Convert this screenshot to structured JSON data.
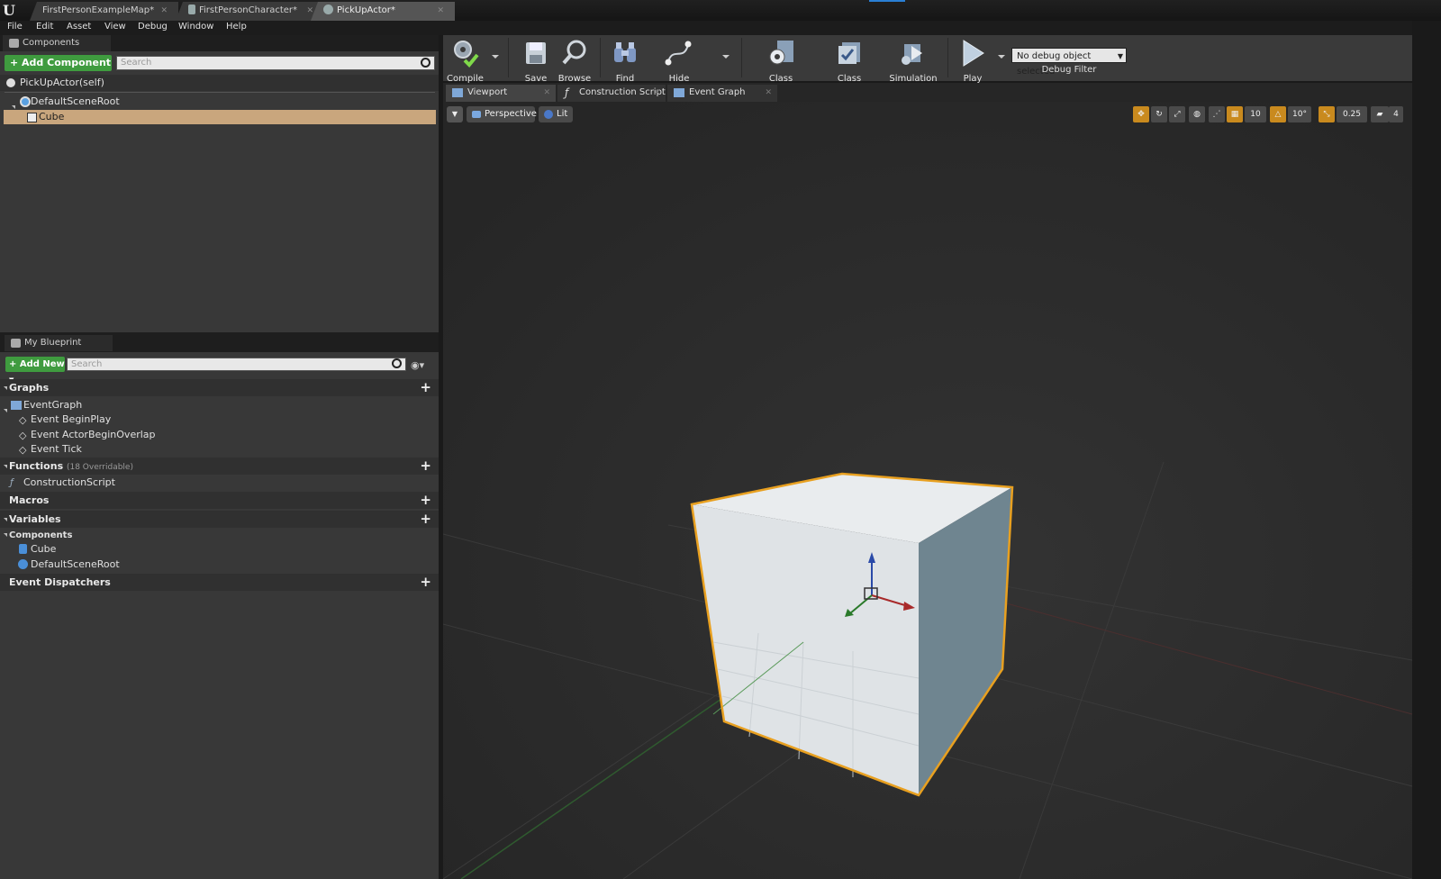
{
  "title_bar": {
    "logo": "U",
    "tabs": [
      {
        "label": "FirstPersonExampleMap*",
        "active": false
      },
      {
        "label": "FirstPersonCharacter*",
        "active": false
      },
      {
        "label": "PickUpActor*",
        "active": true
      }
    ]
  },
  "menu": [
    "File",
    "Edit",
    "Asset",
    "View",
    "Debug",
    "Window",
    "Help"
  ],
  "components_panel": {
    "tab_label": "Components",
    "add_component_label": "+ Add Component",
    "search_placeholder": "Search",
    "self_label": "PickUpActor(self)",
    "tree": [
      {
        "label": "DefaultSceneRoot",
        "selected": false
      },
      {
        "label": "Cube",
        "selected": true
      }
    ]
  },
  "my_blueprint": {
    "tab_label": "My Blueprint",
    "add_new_label": "+ Add New",
    "search_placeholder": "Search",
    "graphs_label": "Graphs",
    "event_graph_label": "EventGraph",
    "events": [
      "Event BeginPlay",
      "Event ActorBeginOverlap",
      "Event Tick"
    ],
    "functions_label": "Functions",
    "functions_note": "(18 Overridable)",
    "functions": [
      "ConstructionScript"
    ],
    "macros_label": "Macros",
    "variables_label": "Variables",
    "components_label": "Components",
    "component_vars": [
      "Cube",
      "DefaultSceneRoot"
    ],
    "event_dispatchers_label": "Event Dispatchers"
  },
  "toolbar": {
    "buttons": [
      {
        "label": "Compile",
        "icon": "compile-icon"
      },
      {
        "label": "Save",
        "icon": "save-icon"
      },
      {
        "label": "Browse",
        "icon": "browse-icon"
      },
      {
        "label": "Find",
        "icon": "find-icon"
      },
      {
        "label": "Hide Unrelated",
        "icon": "hide-unrelated-icon"
      },
      {
        "label": "Class Settings",
        "icon": "class-settings-icon"
      },
      {
        "label": "Class Defaults",
        "icon": "class-defaults-icon"
      },
      {
        "label": "Simulation",
        "icon": "simulation-icon"
      },
      {
        "label": "Play",
        "icon": "play-icon"
      }
    ],
    "debug_select_value": "No debug object selected",
    "debug_filter_label": "Debug Filter"
  },
  "editor_tabs": [
    {
      "label": "Viewport",
      "icon": "viewport-icon",
      "active": true
    },
    {
      "label": "Construction Script",
      "icon": "function-icon",
      "active": false
    },
    {
      "label": "Event Graph",
      "icon": "event-graph-icon",
      "active": false
    }
  ],
  "viewport": {
    "perspective_label": "Perspective",
    "lit_label": "Lit",
    "grid_snap": "10",
    "rotation_snap": "10°",
    "scale_snap": "0.25",
    "camera_speed": "4"
  },
  "colors": {
    "accent_green": "#3f9b3f",
    "selection_tan": "#c9a67d",
    "cube_outline": "#e8a020",
    "viewport_bg": "#2c2c2c"
  }
}
